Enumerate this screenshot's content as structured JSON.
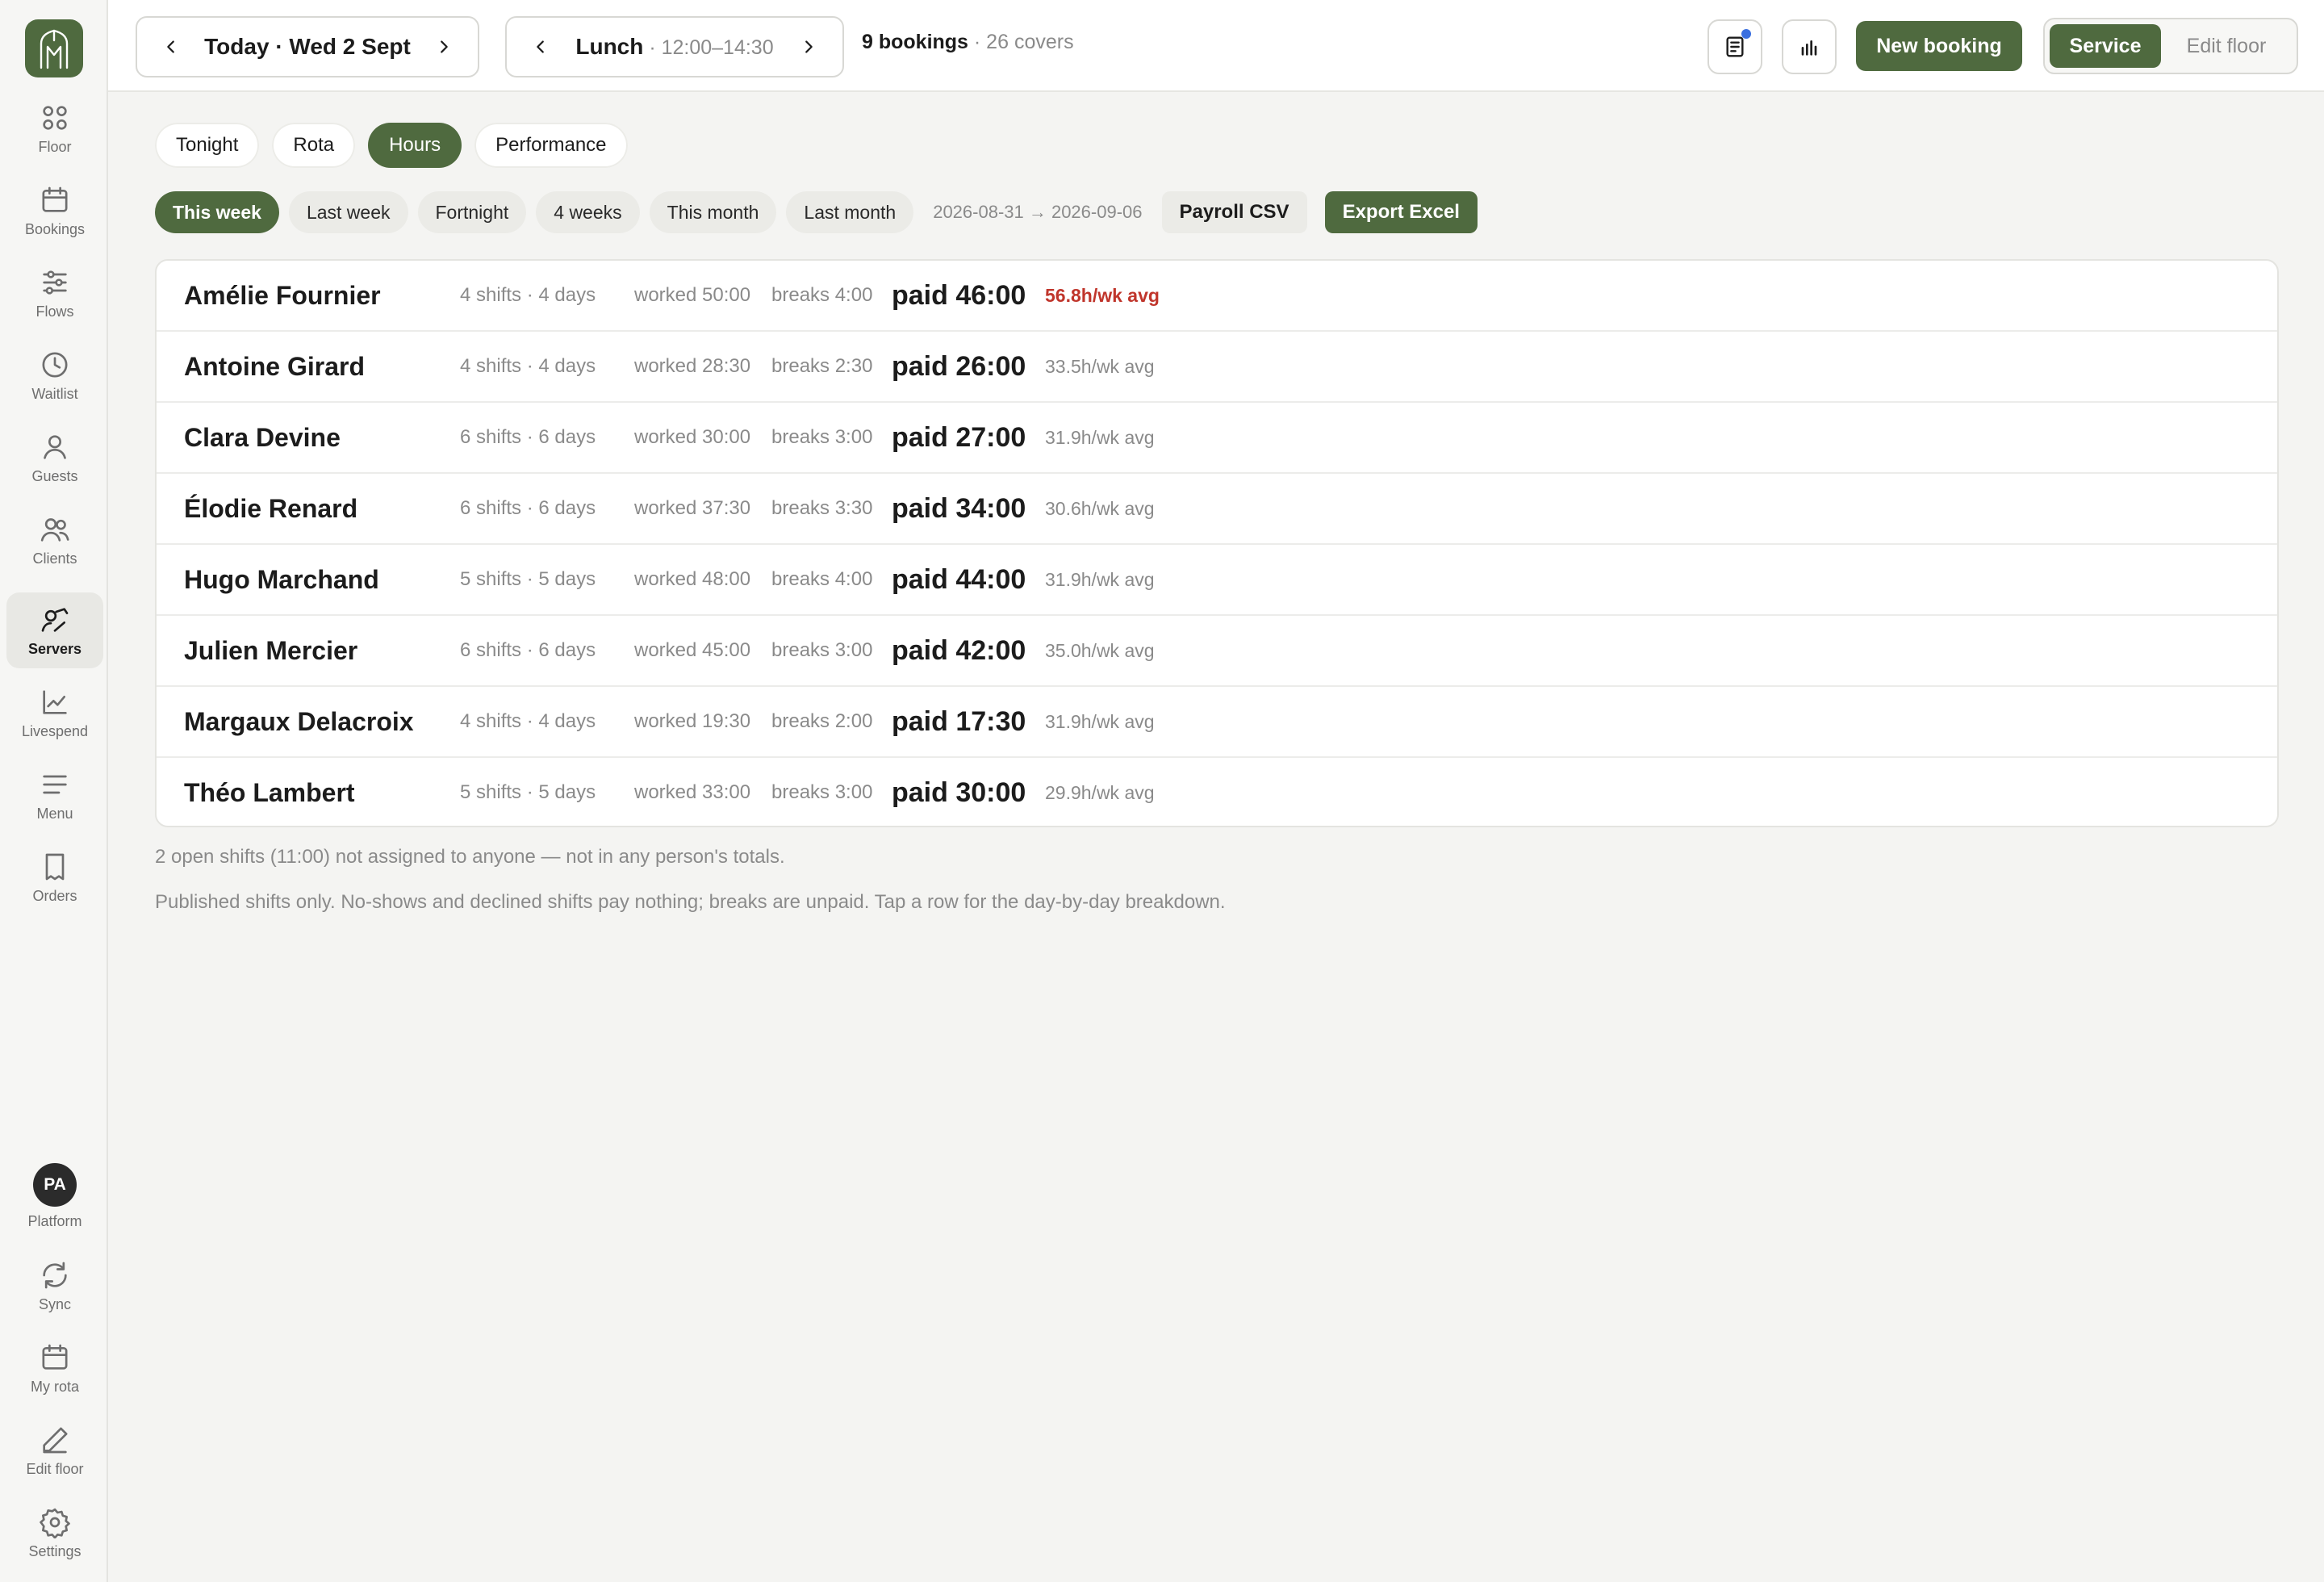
{
  "sidebar": {
    "items": [
      {
        "label": "Floor",
        "icon": "grid-icon"
      },
      {
        "label": "Bookings",
        "icon": "calendar-icon"
      },
      {
        "label": "Flows",
        "icon": "sliders-icon"
      },
      {
        "label": "Waitlist",
        "icon": "clock-icon"
      },
      {
        "label": "Guests",
        "icon": "user-icon"
      },
      {
        "label": "Clients",
        "icon": "users-icon"
      },
      {
        "label": "Servers",
        "icon": "server-person-icon",
        "active": true
      },
      {
        "label": "Livespend",
        "icon": "trend-chart-icon"
      },
      {
        "label": "Menu",
        "icon": "menu-lines-icon"
      },
      {
        "label": "Orders",
        "icon": "receipt-icon"
      }
    ],
    "bottom": {
      "avatar_initials": "PA",
      "platform_label": "Platform",
      "sync_label": "Sync",
      "myrota_label": "My rota",
      "editfloor_label": "Edit floor",
      "settings_label": "Settings"
    }
  },
  "header": {
    "date_label": "Today · Wed 2 Sept",
    "service_label": "Lunch",
    "service_time": " · 12:00–14:30",
    "bookings_count": "9 bookings",
    "covers": " · 26 covers",
    "new_booking_label": "New booking",
    "mode_service_label": "Service",
    "mode_edit_label": "Edit floor"
  },
  "tabs": [
    "Tonight",
    "Rota",
    "Hours",
    "Performance"
  ],
  "active_tab": "Hours",
  "filters": {
    "periods": [
      "This week",
      "Last week",
      "Fortnight",
      "4 weeks",
      "This month",
      "Last month"
    ],
    "active_period": "This week",
    "range": "2026-08-31 → 2026-09-06",
    "payroll_label": "Payroll CSV",
    "export_label": "Export Excel"
  },
  "staff": [
    {
      "name": "Amélie Fournier",
      "shifts": "4 shifts · 4 days",
      "worked": "worked 50:00",
      "breaks": "breaks 4:00",
      "paid": "paid 46:00",
      "avg": "56.8h/wk avg",
      "over": true
    },
    {
      "name": "Antoine Girard",
      "shifts": "4 shifts · 4 days",
      "worked": "worked 28:30",
      "breaks": "breaks 2:30",
      "paid": "paid 26:00",
      "avg": "33.5h/wk avg",
      "over": false
    },
    {
      "name": "Clara Devine",
      "shifts": "6 shifts · 6 days",
      "worked": "worked 30:00",
      "breaks": "breaks 3:00",
      "paid": "paid 27:00",
      "avg": "31.9h/wk avg",
      "over": false
    },
    {
      "name": "Élodie Renard",
      "shifts": "6 shifts · 6 days",
      "worked": "worked 37:30",
      "breaks": "breaks 3:30",
      "paid": "paid 34:00",
      "avg": "30.6h/wk avg",
      "over": false
    },
    {
      "name": "Hugo Marchand",
      "shifts": "5 shifts · 5 days",
      "worked": "worked 48:00",
      "breaks": "breaks 4:00",
      "paid": "paid 44:00",
      "avg": "31.9h/wk avg",
      "over": false
    },
    {
      "name": "Julien Mercier",
      "shifts": "6 shifts · 6 days",
      "worked": "worked 45:00",
      "breaks": "breaks 3:00",
      "paid": "paid 42:00",
      "avg": "35.0h/wk avg",
      "over": false
    },
    {
      "name": "Margaux Delacroix",
      "shifts": "4 shifts · 4 days",
      "worked": "worked 19:30",
      "breaks": "breaks 2:00",
      "paid": "paid 17:30",
      "avg": "31.9h/wk avg",
      "over": false
    },
    {
      "name": "Théo Lambert",
      "shifts": "5 shifts · 5 days",
      "worked": "worked 33:00",
      "breaks": "breaks 3:00",
      "paid": "paid 30:00",
      "avg": "29.9h/wk avg",
      "over": false
    }
  ],
  "notes": {
    "open_shifts": "2 open shifts (11:00) not assigned to anyone — not in any person's totals.",
    "footnote": "Published shifts only. No-shows and declined shifts pay nothing; breaks are unpaid. Tap a row for the day-by-day breakdown."
  },
  "colors": {
    "accent": "#4f6a3f",
    "alert": "#c0352b",
    "notification_dot": "#3a6fe0"
  }
}
